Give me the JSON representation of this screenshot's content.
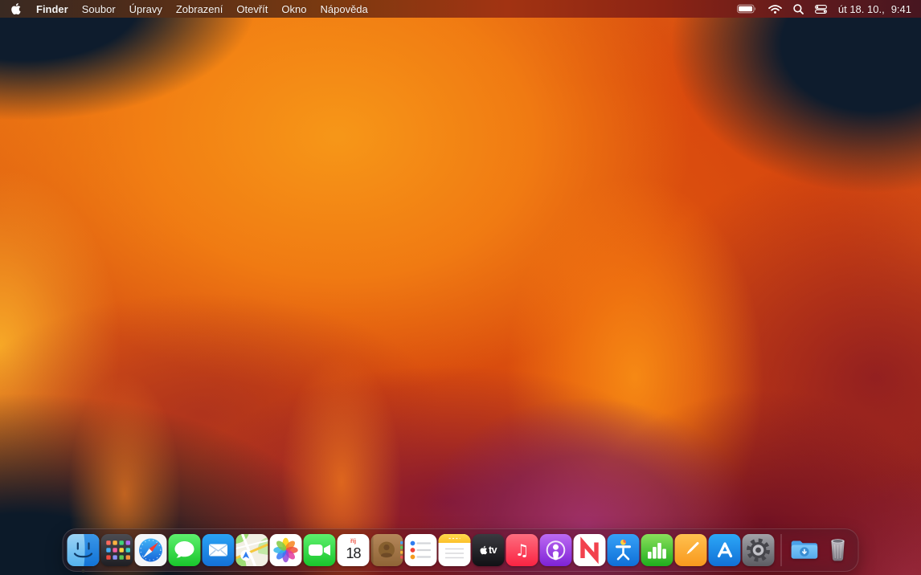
{
  "menubar": {
    "app_menu": "Finder",
    "menus": [
      "Soubor",
      "Úpravy",
      "Zobrazení",
      "Otevřít",
      "Okno",
      "Nápověda"
    ],
    "clock": {
      "date": "út 18. 10.,",
      "time": "9:41"
    },
    "status_icons": [
      "battery-icon",
      "wifi-icon",
      "spotlight-search-icon",
      "control-center-icon"
    ]
  },
  "dock": {
    "apps": [
      "finder",
      "launchpad",
      "safari",
      "messages",
      "mail",
      "maps",
      "photos",
      "facetime",
      "calendar",
      "contacts",
      "reminders",
      "notes",
      "tv",
      "music",
      "podcasts",
      "news",
      "keynote",
      "numbers",
      "pages",
      "app-store",
      "system-settings"
    ],
    "trailing": [
      "downloads-folder",
      "trash"
    ],
    "finder_running": true,
    "calendar_badge": {
      "month": "říj",
      "day": "18"
    },
    "tv_glyph": "tv",
    "music_glyph": "♫"
  },
  "colors": {
    "menubar_left": "#3a2a22",
    "menubar_right": "#471620",
    "wallpaper_navy": "#0d1b2b",
    "wallpaper_orange": "#f29018",
    "wallpaper_red": "#c03414",
    "wallpaper_purple": "#8c3368",
    "dock_background": "rgba(48,30,40,0.45)"
  }
}
